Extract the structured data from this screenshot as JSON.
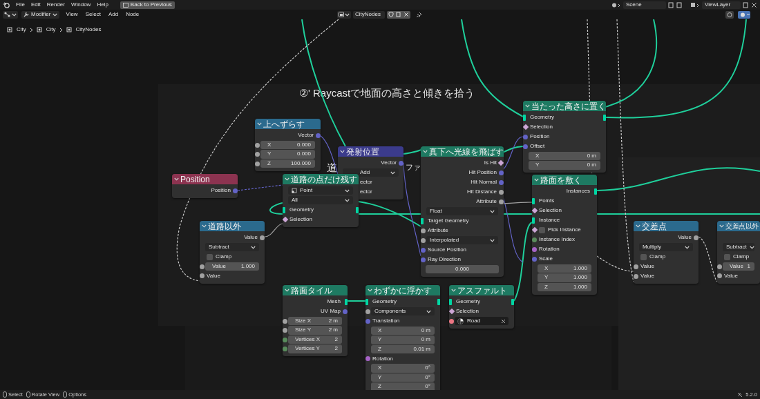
{
  "menu": [
    "File",
    "Edit",
    "Render",
    "Window",
    "Help"
  ],
  "back_button": "Back to Previous",
  "editor_header": {
    "mode": "Modifier",
    "menus": [
      "View",
      "Select",
      "Add",
      "Node"
    ],
    "node_tree": "CityNodes"
  },
  "scene": "Scene",
  "view_layer": "ViewLayer",
  "breadcrumbs": [
    "City",
    "City",
    "CityNodes"
  ],
  "frames": [
    {
      "label": "②' Raycastで地面の高さと傾きを拾う"
    },
    {
      "label": "道"
    },
    {
      "label": "ファ"
    }
  ],
  "nodes": [
    {
      "title": "上へずらす",
      "color": "#2b6a8d",
      "rows": [
        {
          "kind": "output",
          "label": "Vector",
          "color": "#6363c7"
        },
        {
          "kind": "number",
          "label": "X",
          "value": "0.000",
          "color": "#a1a1a1"
        },
        {
          "kind": "number",
          "label": "Y",
          "value": "0.000",
          "color": "#a1a1a1"
        },
        {
          "kind": "number",
          "label": "Z",
          "value": "100.000",
          "color": "#a1a1a1"
        }
      ]
    },
    {
      "title": "Position",
      "color": "#8c3350",
      "rows": [
        {
          "kind": "output",
          "label": "Position",
          "color": "#6363c7"
        }
      ]
    },
    {
      "title": "発射位置",
      "color": "#3b3b8c",
      "rows": [
        {
          "kind": "output",
          "label": "Vector",
          "color": "#6363c7"
        },
        {
          "kind": "partial-dropdown",
          "value": "Add"
        },
        {
          "kind": "partial-input",
          "label": "ector"
        },
        {
          "kind": "partial-input",
          "label": "ector"
        }
      ]
    },
    {
      "title": "道路の点だけ残す",
      "color": "#1e7a62",
      "rows": [
        {
          "kind": "icon-dropdown",
          "value": "Point"
        },
        {
          "kind": "dropdown",
          "value": "All"
        },
        {
          "kind": "io",
          "label": "Geometry",
          "color": "#00d6a3"
        },
        {
          "kind": "input",
          "label": "Selection",
          "color": "#cca6d6"
        }
      ]
    },
    {
      "title": "道路以外",
      "color": "#2b6a8d",
      "rows": [
        {
          "kind": "output",
          "label": "Value",
          "color": "#a1a1a1"
        },
        {
          "kind": "dropdown",
          "value": "Subtract"
        },
        {
          "kind": "checkbox",
          "label": "Clamp",
          "checked": false
        },
        {
          "kind": "number",
          "label": "Value",
          "value": "1.000",
          "color": "#a1a1a1"
        },
        {
          "kind": "input",
          "label": "Value",
          "color": "#a1a1a1"
        }
      ]
    },
    {
      "title": "真下へ光線を飛ばす",
      "color": "#1e7a62",
      "rows": [
        {
          "kind": "output",
          "label": "Is Hit",
          "color": "#cca6d6"
        },
        {
          "kind": "output",
          "label": "Hit Position",
          "color": "#6363c7"
        },
        {
          "kind": "output",
          "label": "Hit Normal",
          "color": "#6363c7"
        },
        {
          "kind": "output",
          "label": "Hit Distance",
          "color": "#a1a1a1"
        },
        {
          "kind": "output",
          "label": "Attribute",
          "color": "#a1a1a1"
        },
        {
          "kind": "dropdown",
          "value": "Float"
        },
        {
          "kind": "input",
          "label": "Target Geometry",
          "color": "#00d6a3"
        },
        {
          "kind": "input",
          "label": "Attribute",
          "color": "#a1a1a1"
        },
        {
          "kind": "dropdown",
          "value": "Interpolated",
          "color": "#a1a1a1"
        },
        {
          "kind": "input",
          "label": "Source Position",
          "color": "#6363c7"
        },
        {
          "kind": "input",
          "label": "Ray Direction",
          "color": "#6363c7"
        },
        {
          "kind": "value",
          "value": "0.000"
        }
      ]
    },
    {
      "title": "当たった高さに置く",
      "color": "#1e7a62",
      "rows": [
        {
          "kind": "io",
          "label": "Geometry",
          "color": "#00d6a3"
        },
        {
          "kind": "input",
          "label": "Selection",
          "color": "#cca6d6"
        },
        {
          "kind": "input",
          "label": "Position",
          "color": "#6363c7"
        },
        {
          "kind": "input",
          "label": "Offset",
          "color": "#6363c7"
        },
        {
          "kind": "number",
          "label": "X",
          "value": "0 m"
        },
        {
          "kind": "number",
          "label": "Y",
          "value": "0 m"
        }
      ]
    },
    {
      "title": "路面を敷く",
      "color": "#1e7a62",
      "rows": [
        {
          "kind": "output",
          "label": "Instances",
          "color": "#00d6a3"
        },
        {
          "kind": "input",
          "label": "Points",
          "color": "#00d6a3"
        },
        {
          "kind": "input",
          "label": "Selection",
          "color": "#cca6d6"
        },
        {
          "kind": "input",
          "label": "Instance",
          "color": "#00d6a3"
        },
        {
          "kind": "checkbox",
          "label": "Pick Instance",
          "checked": false,
          "color": "#cca6d6"
        },
        {
          "kind": "input",
          "label": "Instance Index",
          "color": "#598c5c"
        },
        {
          "kind": "input",
          "label": "Rotation",
          "color": "#a663c7"
        },
        {
          "kind": "input",
          "label": "Scale",
          "color": "#6363c7"
        },
        {
          "kind": "number",
          "label": "X",
          "value": "1.000"
        },
        {
          "kind": "number",
          "label": "Y",
          "value": "1.000"
        },
        {
          "kind": "number",
          "label": "Z",
          "value": "1.000"
        }
      ]
    },
    {
      "title": "交差点",
      "color": "#2b6a8d",
      "rows": [
        {
          "kind": "output",
          "label": "Value",
          "color": "#a1a1a1"
        },
        {
          "kind": "dropdown",
          "value": "Multiply"
        },
        {
          "kind": "checkbox",
          "label": "Clamp",
          "checked": false
        },
        {
          "kind": "input",
          "label": "Value",
          "color": "#a1a1a1"
        },
        {
          "kind": "input",
          "label": "Value",
          "color": "#a1a1a1"
        }
      ]
    },
    {
      "title": "交差点以外",
      "color": "#2b6a8d",
      "rows": [
        {
          "kind": "spacer"
        },
        {
          "kind": "dropdown",
          "value": "Subtract"
        },
        {
          "kind": "checkbox",
          "label": "Clamp",
          "checked": false
        },
        {
          "kind": "number",
          "label": "Value",
          "value": "1",
          "color": "#a1a1a1"
        },
        {
          "kind": "input",
          "label": "Value",
          "color": "#a1a1a1"
        }
      ]
    },
    {
      "title": "路面タイル",
      "color": "#1e7a62",
      "rows": [
        {
          "kind": "output",
          "label": "Mesh",
          "color": "#00d6a3"
        },
        {
          "kind": "output",
          "label": "UV Map",
          "color": "#6363c7"
        },
        {
          "kind": "number",
          "label": "Size X",
          "value": "2 m",
          "color": "#a1a1a1"
        },
        {
          "kind": "number",
          "label": "Size Y",
          "value": "2 m",
          "color": "#a1a1a1"
        },
        {
          "kind": "number",
          "label": "Vertices X",
          "value": "2",
          "color": "#598c5c"
        },
        {
          "kind": "number",
          "label": "Vertices Y",
          "value": "2",
          "color": "#598c5c"
        }
      ]
    },
    {
      "title": "わずかに浮かす",
      "color": "#1e7a62",
      "rows": [
        {
          "kind": "io",
          "label": "Geometry",
          "color": "#00d6a3"
        },
        {
          "kind": "dropdown",
          "value": "Components",
          "color": "#a1a1a1"
        },
        {
          "kind": "input",
          "label": "Translation",
          "color": "#6363c7"
        },
        {
          "kind": "number",
          "label": "X",
          "value": "0 m"
        },
        {
          "kind": "number",
          "label": "Y",
          "value": "0 m"
        },
        {
          "kind": "number",
          "label": "Z",
          "value": "0.01 m"
        },
        {
          "kind": "input",
          "label": "Rotation",
          "color": "#a663c7"
        },
        {
          "kind": "number",
          "label": "X",
          "value": "0°"
        },
        {
          "kind": "number",
          "label": "Y",
          "value": "0°"
        },
        {
          "kind": "number",
          "label": "Z",
          "value": "0°"
        }
      ]
    },
    {
      "title": "アスファルト",
      "color": "#1e7a62",
      "rows": [
        {
          "kind": "io",
          "label": "Geometry",
          "color": "#00d6a3"
        },
        {
          "kind": "input",
          "label": "Selection",
          "color": "#cca6d6"
        },
        {
          "kind": "object",
          "value": "Road",
          "color": "#eb7582"
        }
      ]
    }
  ],
  "status_bar": {
    "hints": [
      "Select",
      "Rotate View",
      "Options"
    ],
    "version": "5.2.0"
  }
}
